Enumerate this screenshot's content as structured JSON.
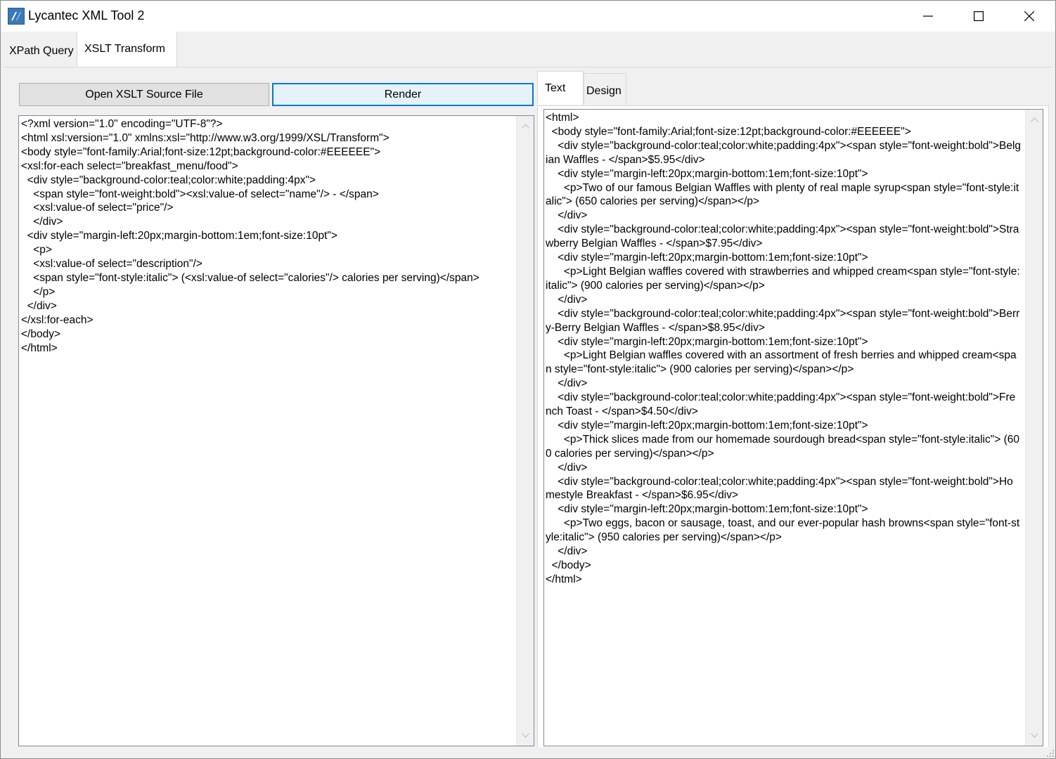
{
  "window": {
    "title": "Lycantec XML Tool 2",
    "icon": "app-logo-icon"
  },
  "title_bar_controls": {
    "minimize_icon": "minimize-icon",
    "maximize_icon": "maximize-icon",
    "close_icon": "close-icon"
  },
  "tabs": [
    {
      "label": "XPath Query",
      "active": false
    },
    {
      "label": "XSLT Transform",
      "active": true
    }
  ],
  "toolbar": {
    "open_label": "Open XSLT Source File",
    "render_label": "Render"
  },
  "xslt_source": {
    "lines": [
      "<?xml version=\"1.0\" encoding=\"UTF-8\"?>",
      "<html xsl:version=\"1.0\" xmlns:xsl=\"http://www.w3.org/1999/XSL/Transform\">",
      "<body style=\"font-family:Arial;font-size:12pt;background-color:#EEEEEE\">",
      "<xsl:for-each select=\"breakfast_menu/food\">",
      "  <div style=\"background-color:teal;color:white;padding:4px\">",
      "    <span style=\"font-weight:bold\"><xsl:value-of select=\"name\"/> - </span>",
      "    <xsl:value-of select=\"price\"/>",
      "    </div>",
      "  <div style=\"margin-left:20px;margin-bottom:1em;font-size:10pt\">",
      "    <p>",
      "    <xsl:value-of select=\"description\"/>",
      "    <span style=\"font-style:italic\"> (<xsl:value-of select=\"calories\"/> calories per serving)</span>",
      "    </p>",
      "  </div>",
      "</xsl:for-each>",
      "</body>",
      "</html>"
    ]
  },
  "output_tabs": [
    {
      "label": "Text",
      "active": true
    },
    {
      "label": "Design",
      "active": false
    }
  ],
  "output_text": {
    "lines": [
      "<html>",
      "  <body style=\"font-family:Arial;font-size:12pt;background-color:#EEEEEE\">",
      "    <div style=\"background-color:teal;color:white;padding:4px\"><span style=\"font-weight:bold\">Belgian Waffles - </span>$5.95</div>",
      "    <div style=\"margin-left:20px;margin-bottom:1em;font-size:10pt\">",
      "      <p>Two of our famous Belgian Waffles with plenty of real maple syrup<span style=\"font-style:italic\"> (650 calories per serving)</span></p>",
      "    </div>",
      "    <div style=\"background-color:teal;color:white;padding:4px\"><span style=\"font-weight:bold\">Strawberry Belgian Waffles - </span>$7.95</div>",
      "    <div style=\"margin-left:20px;margin-bottom:1em;font-size:10pt\">",
      "      <p>Light Belgian waffles covered with strawberries and whipped cream<span style=\"font-style:italic\"> (900 calories per serving)</span></p>",
      "    </div>",
      "    <div style=\"background-color:teal;color:white;padding:4px\"><span style=\"font-weight:bold\">Berry-Berry Belgian Waffles - </span>$8.95</div>",
      "    <div style=\"margin-left:20px;margin-bottom:1em;font-size:10pt\">",
      "      <p>Light Belgian waffles covered with an assortment of fresh berries and whipped cream<span style=\"font-style:italic\"> (900 calories per serving)</span></p>",
      "    </div>",
      "    <div style=\"background-color:teal;color:white;padding:4px\"><span style=\"font-weight:bold\">French Toast - </span>$4.50</div>",
      "    <div style=\"margin-left:20px;margin-bottom:1em;font-size:10pt\">",
      "      <p>Thick slices made from our homemade sourdough bread<span style=\"font-style:italic\"> (600 calories per serving)</span></p>",
      "    </div>",
      "    <div style=\"background-color:teal;color:white;padding:4px\"><span style=\"font-weight:bold\">Homestyle Breakfast - </span>$6.95</div>",
      "    <div style=\"margin-left:20px;margin-bottom:1em;font-size:10pt\">",
      "      <p>Two eggs, bacon or sausage, toast, and our ever-popular hash browns<span style=\"font-style:italic\"> (950 calories per serving)</span></p>",
      "    </div>",
      "  </body>",
      "</html>"
    ]
  },
  "colors": {
    "focus_border": "#0078d7",
    "button_face": "#e1e1e1",
    "window_bg": "#f0f0f0"
  }
}
